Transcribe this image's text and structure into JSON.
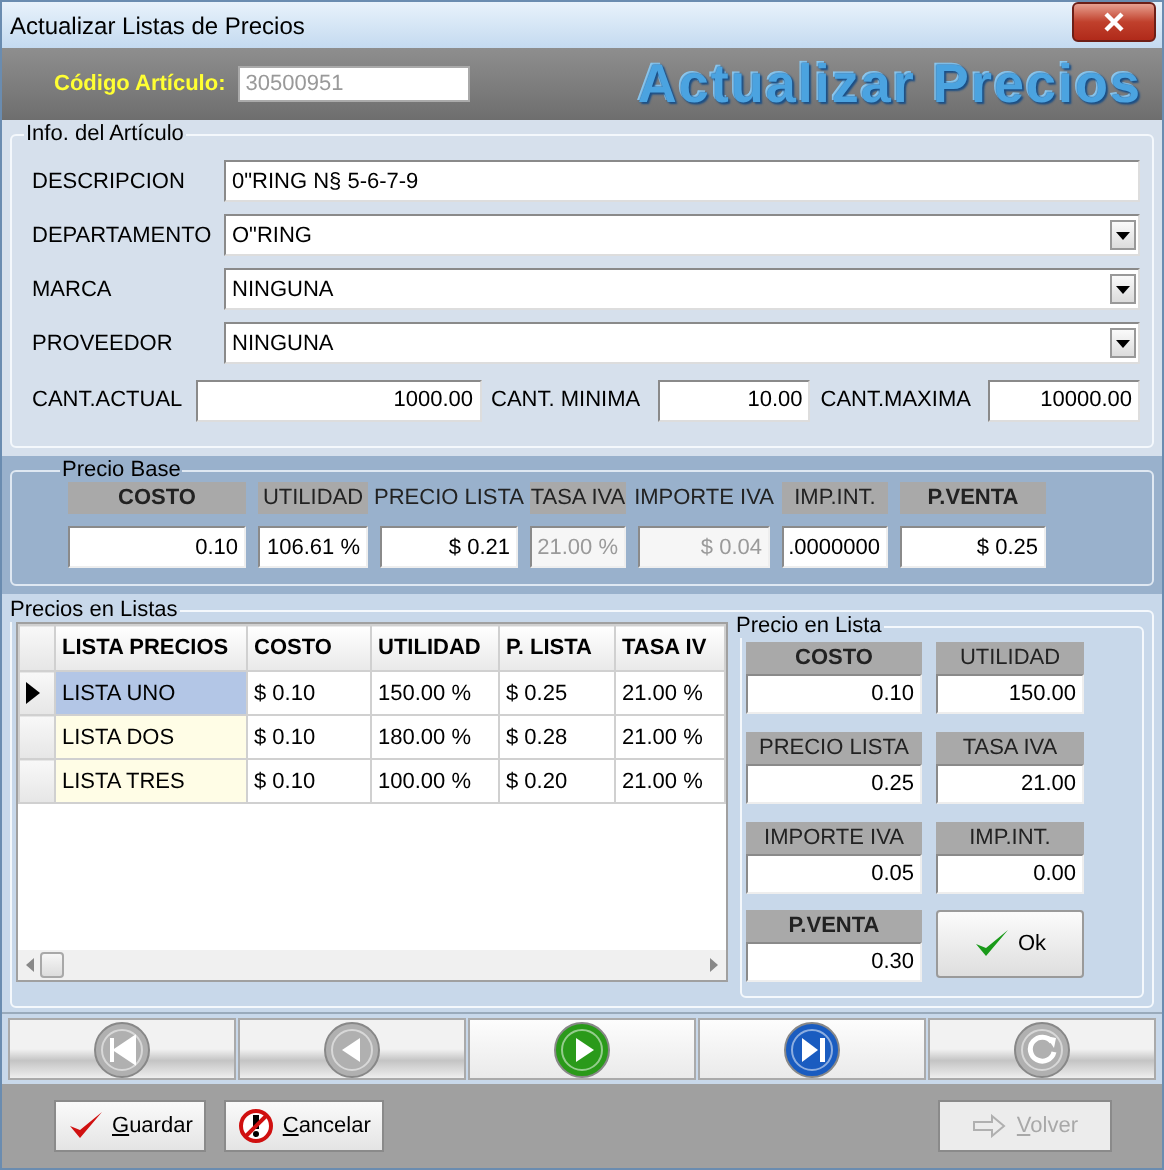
{
  "window": {
    "title": "Actualizar Listas de Precios"
  },
  "header": {
    "code_label": "Código Artículo:",
    "code_value": "30500951",
    "banner": "Actualizar Precios"
  },
  "article_info": {
    "title": "Info. del Artículo",
    "fields": [
      {
        "label": "DESCRIPCION",
        "value": "0\"RING N§ 5-6-7-9",
        "kind": "text"
      },
      {
        "label": "DEPARTAMENTO",
        "value": "O\"RING",
        "kind": "combo"
      },
      {
        "label": "MARCA",
        "value": "NINGUNA",
        "kind": "combo"
      },
      {
        "label": "PROVEEDOR",
        "value": "NINGUNA",
        "kind": "combo"
      }
    ],
    "quantities": [
      {
        "label": "CANT.ACTUAL",
        "value": "1000.00"
      },
      {
        "label": "CANT. MINIMA",
        "value": "10.00"
      },
      {
        "label": "CANT.MAXIMA",
        "value": "10000.00"
      }
    ]
  },
  "base_price": {
    "title": "Precio Base",
    "columns": [
      {
        "label": "COSTO",
        "value": "0.10",
        "bold": true,
        "shaded": true,
        "disabled": false
      },
      {
        "label": "UTILIDAD",
        "value": "106.61 %",
        "bold": false,
        "shaded": true,
        "disabled": false
      },
      {
        "label": "PRECIO LISTA",
        "value": "$ 0.21",
        "bold": false,
        "shaded": false,
        "disabled": false
      },
      {
        "label": "TASA IVA",
        "value": "21.00 %",
        "bold": false,
        "shaded": true,
        "disabled": true
      },
      {
        "label": "IMPORTE IVA",
        "value": "$ 0.04",
        "bold": false,
        "shaded": false,
        "disabled": true
      },
      {
        "label": "IMP.INT.",
        "value": ".0000000",
        "bold": false,
        "shaded": true,
        "disabled": false
      },
      {
        "label": "P.VENTA",
        "value": "$ 0.25",
        "bold": true,
        "shaded": true,
        "disabled": false
      }
    ]
  },
  "price_lists": {
    "title": "Precios en Listas",
    "table": {
      "columns": [
        "LISTA PRECIOS",
        "COSTO",
        "UTILIDAD",
        "P. LISTA",
        "TASA IV"
      ],
      "rows": [
        {
          "cells": [
            "LISTA UNO",
            "$ 0.10",
            "150.00 %",
            "$ 0.25",
            "21.00 %"
          ],
          "selected": true
        },
        {
          "cells": [
            "LISTA DOS",
            "$ 0.10",
            "180.00 %",
            "$ 0.28",
            "21.00 %"
          ],
          "selected": false
        },
        {
          "cells": [
            "LISTA TRES",
            "$ 0.10",
            "100.00 %",
            "$ 0.20",
            "21.00 %"
          ],
          "selected": false
        }
      ]
    }
  },
  "list_price": {
    "title": "Precio en Lista",
    "fields": [
      {
        "label": "COSTO",
        "value": "0.10",
        "bold": true
      },
      {
        "label": "UTILIDAD",
        "value": "150.00",
        "bold": false
      },
      {
        "label": "PRECIO LISTA",
        "value": "0.25",
        "bold": false
      },
      {
        "label": "TASA IVA",
        "value": "21.00",
        "bold": false
      },
      {
        "label": "IMPORTE IVA",
        "value": "0.05",
        "bold": false
      },
      {
        "label": "IMP.INT.",
        "value": "0.00",
        "bold": false
      },
      {
        "label": "P.VENTA",
        "value": "0.30",
        "bold": true
      }
    ],
    "ok_button": "Ok"
  },
  "navigation": [
    {
      "kind": "first",
      "disabled": true,
      "color": "#b0b0b0"
    },
    {
      "kind": "previous",
      "disabled": true,
      "color": "#b0b0b0"
    },
    {
      "kind": "next",
      "disabled": false,
      "color": "#2a9a1a"
    },
    {
      "kind": "last",
      "disabled": false,
      "color": "#1a5cc0"
    },
    {
      "kind": "refresh",
      "disabled": true,
      "color": "#b0b0b0"
    }
  ],
  "buttons": [
    {
      "label": "Guardar",
      "kind": "save",
      "disabled": false
    },
    {
      "label": "Cancelar",
      "kind": "cancel",
      "disabled": false
    },
    {
      "label": "Volver",
      "kind": "back",
      "disabled": true
    }
  ]
}
